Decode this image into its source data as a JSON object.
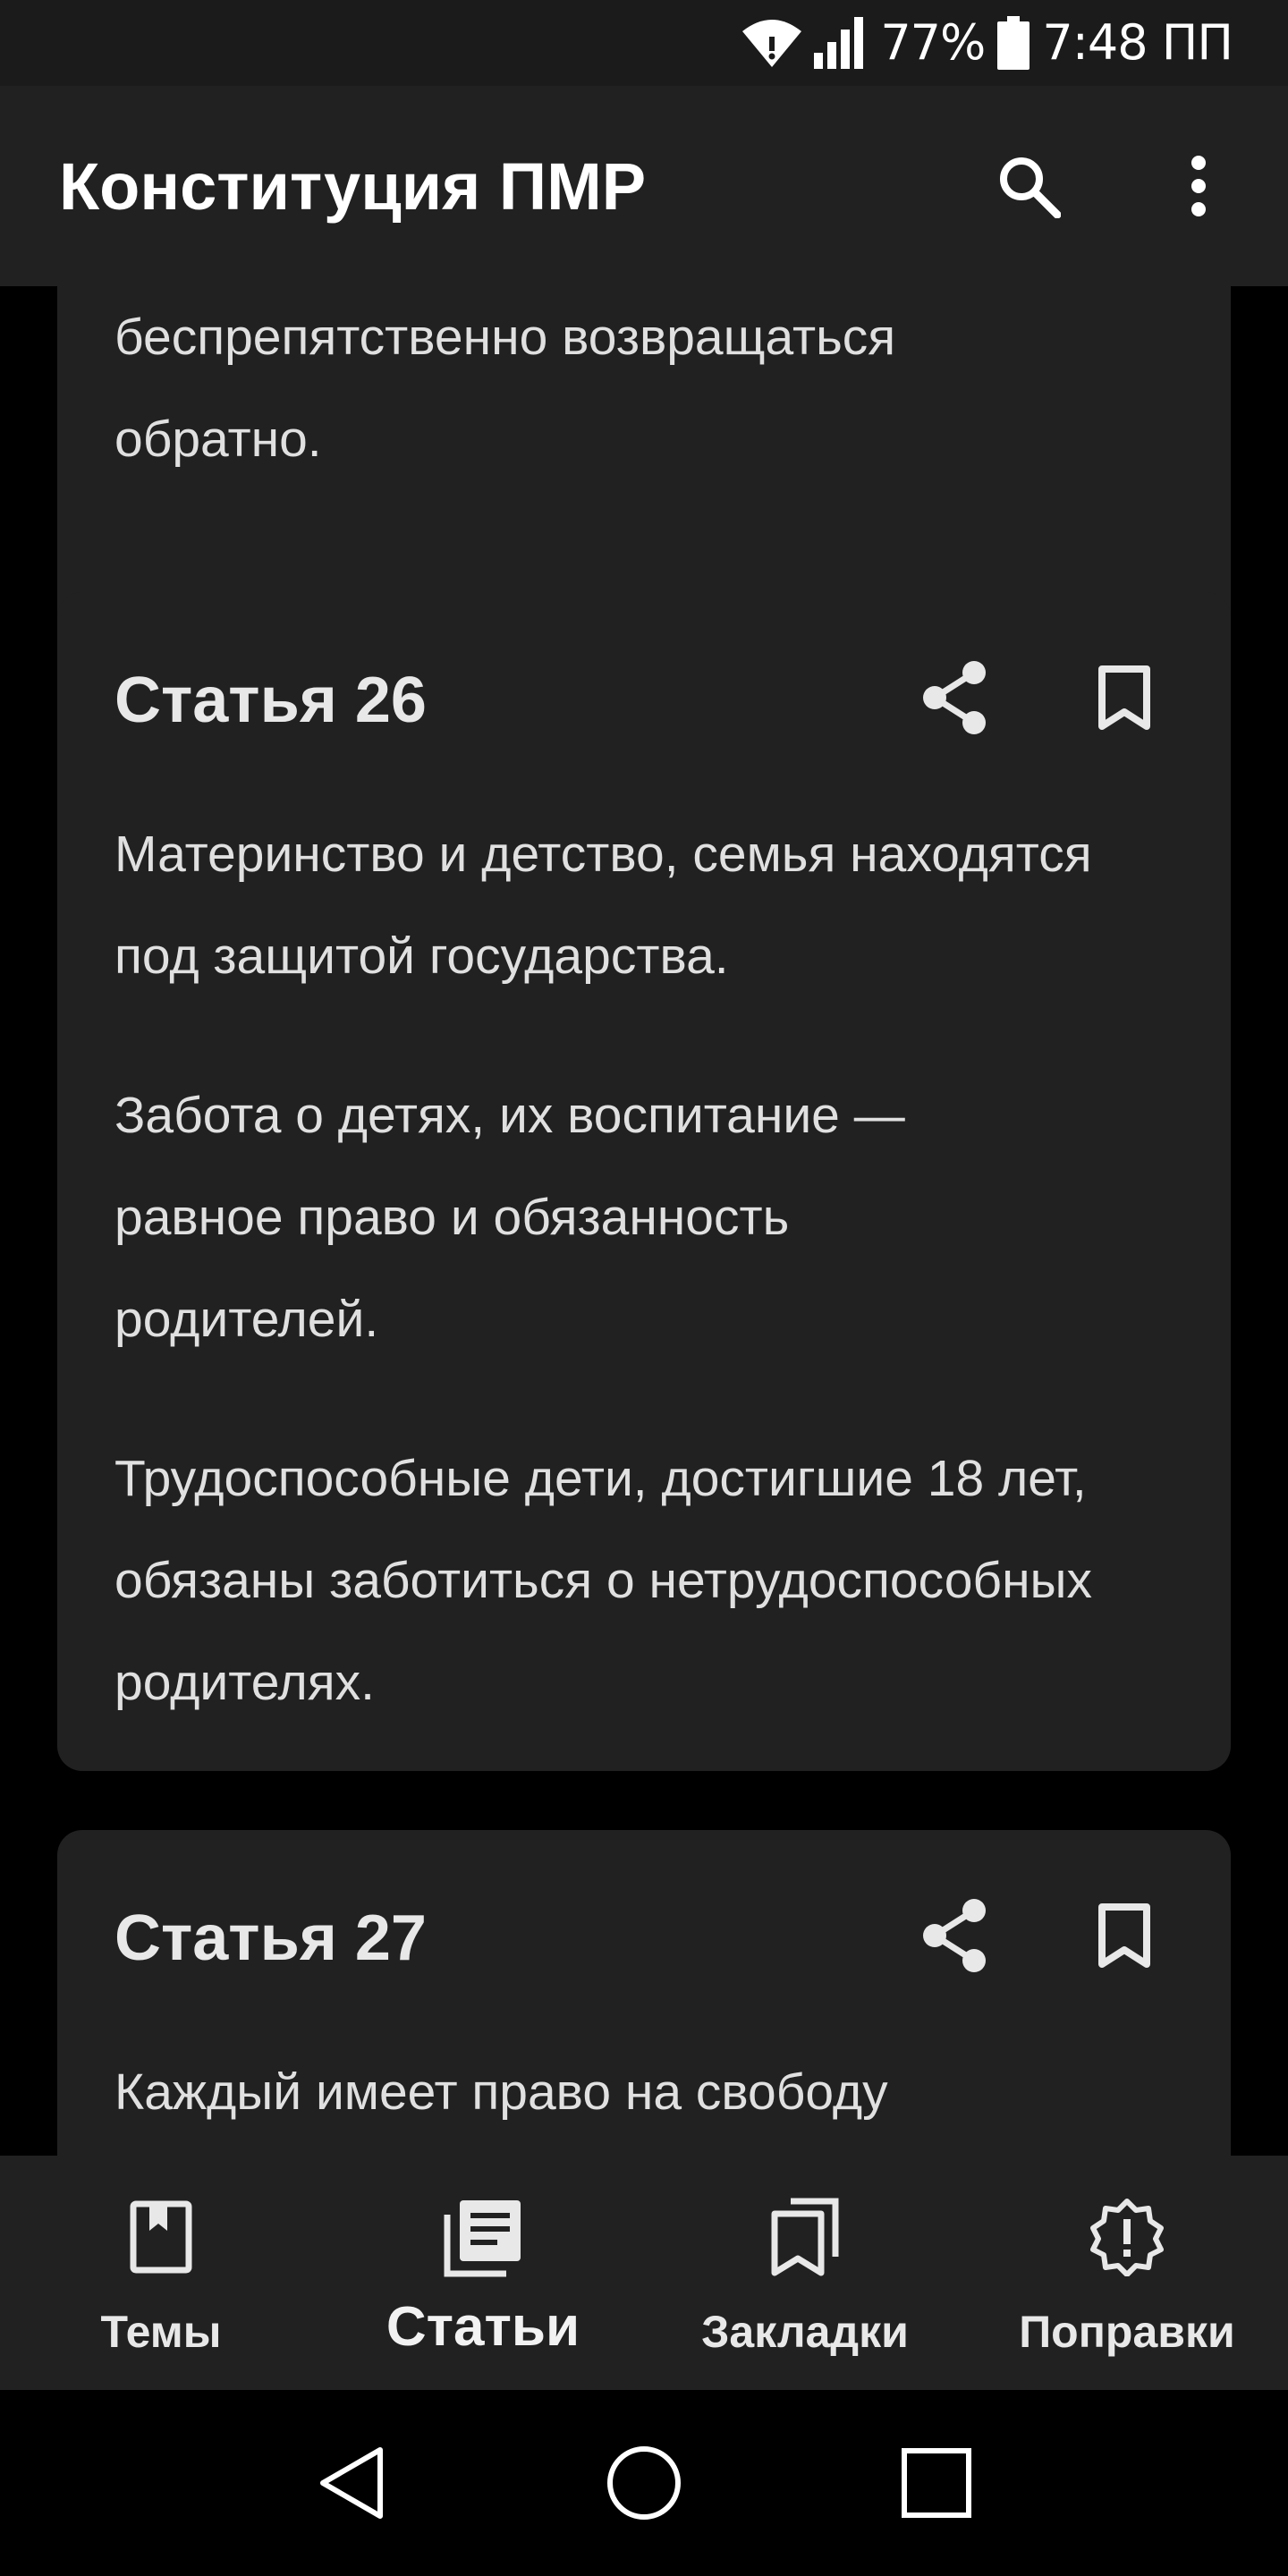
{
  "status_bar": {
    "battery": "77%",
    "time": "7:48 ПП",
    "icons": [
      "wifi-icon",
      "signal-icon",
      "battery-icon"
    ]
  },
  "app_bar": {
    "title": "Конституция ПМР",
    "icons": [
      "search-icon",
      "more-vert-icon"
    ]
  },
  "articles": {
    "previous": {
      "text": "беспрепятственно возвращаться обратно."
    },
    "article_26": {
      "title": "Статья 26",
      "paragraphs": [
        "Материнство и детство, семья находятся под защитой государства.",
        "Забота о детях, их воспитание — равное право и обязанность родителей.",
        "Трудоспособные дети, достигшие 18 лет, обязаны заботиться о нетрудоспособных родителях."
      ]
    },
    "article_27": {
      "title": "Статья 27",
      "paragraphs": [
        "Каждый имеет право на свободу"
      ]
    },
    "action_icons": [
      "share-icon",
      "bookmark-icon"
    ]
  },
  "bottom_nav": {
    "items": [
      {
        "label": "Темы",
        "icon": "book-icon",
        "active": false
      },
      {
        "label": "Статьи",
        "icon": "articles-icon",
        "active": true
      },
      {
        "label": "Закладки",
        "icon": "bookmarks-icon",
        "active": false
      },
      {
        "label": "Поправки",
        "icon": "alert-badge-icon",
        "active": false
      }
    ]
  },
  "system_nav": [
    "back-icon",
    "home-icon",
    "recents-icon"
  ],
  "colors": {
    "background": "#000000",
    "surface": "#212121",
    "text": "#e8e8e8"
  }
}
